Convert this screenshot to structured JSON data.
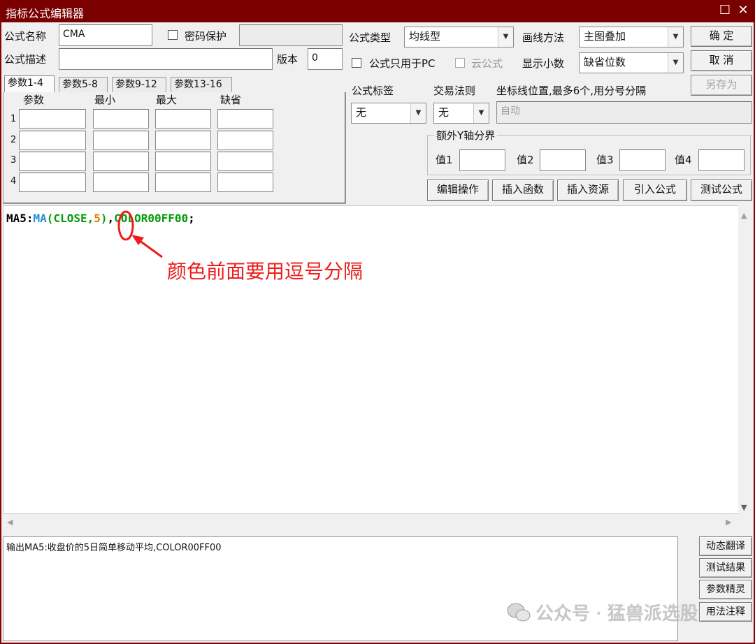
{
  "window": {
    "title": "指标公式编辑器",
    "restore_glyph": "☐",
    "close_glyph": "✕"
  },
  "form": {
    "name_label": "公式名称",
    "name_value": "CMA",
    "password_label": "密码保护",
    "password_value": "",
    "desc_label": "公式描述",
    "desc_value": "",
    "version_label": "版本",
    "version_value": "0",
    "type_label": "公式类型",
    "type_value": "均线型",
    "draw_label": "画线方法",
    "draw_value": "主图叠加",
    "pc_only_label": "公式只用于PC",
    "cloud_label": "云公式",
    "decimals_label": "显示小数",
    "decimals_value": "缺省位数",
    "tag_label": "公式标签",
    "tag_value": "无",
    "trade_label": "交易法则",
    "trade_value": "无",
    "axis_label": "坐标线位置,最多6个,用分号分隔",
    "axis_value": "自动",
    "extra_y_label": "额外Y轴分界",
    "extra_y_values": [
      "值1",
      "值2",
      "值3",
      "值4"
    ]
  },
  "buttons": {
    "ok": "确  定",
    "cancel": "取  消",
    "save_as": "另存为",
    "edit_ops": "编辑操作",
    "insert_func": "插入函数",
    "insert_res": "插入资源",
    "import": "引入公式",
    "test": "测试公式"
  },
  "params": {
    "tabs": [
      "参数1-4",
      "参数5-8",
      "参数9-12",
      "参数13-16"
    ],
    "headers": [
      "参数",
      "最小",
      "最大",
      "缺省"
    ],
    "rows": [
      "1",
      "2",
      "3",
      "4"
    ]
  },
  "code": {
    "t1": "MA5:",
    "t2": "MA",
    "t3": "(",
    "t4": "CLOSE",
    "t5": ",",
    "t6": "5",
    "t7": ")",
    "t8": ",",
    "t9": "COLOR00FF00",
    "t10": ";"
  },
  "colors": {
    "code_black": "#000000",
    "code_blue": "#1f8fd8",
    "code_green": "#0a9a0a",
    "code_orange": "#e07b00",
    "annotation_red": "#ee1c1c"
  },
  "annotation": "颜色前面要用逗号分隔",
  "output_text": "输出MA5:收盘价的5日简单移动平均,COLOR00FF00",
  "side_buttons": [
    "动态翻译",
    "测试结果",
    "参数精灵",
    "用法注释"
  ],
  "watermark": "公众号 · 猛兽派选股",
  "icons": {
    "dropdown": "▼",
    "up": "▲",
    "down": "▼",
    "left": "◀",
    "right": "▶"
  }
}
